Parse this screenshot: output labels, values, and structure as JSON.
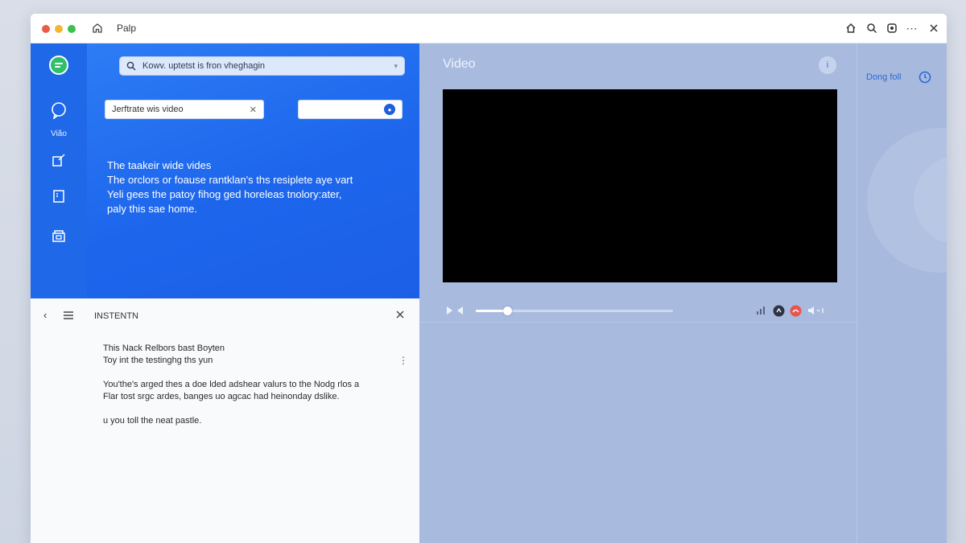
{
  "window": {
    "title": "Palp"
  },
  "rail": {
    "video_label": "Vião"
  },
  "search": {
    "value": "Kowv. uptetst is fron vheghagin"
  },
  "fields": {
    "title_value": "Jerftrate wis video"
  },
  "blue_text": {
    "line1": "The taakeir wide vides",
    "line2": "The orclors or foause rantklan's ths resiplete aye vart",
    "line3": "Yeli gees the patoy fihog ged horeleas tnolory:ater,",
    "line4": "paly this sae home."
  },
  "info_panel": {
    "header": "INSTENTN",
    "line1": "This Nack Relbors bast Boyten",
    "line2": "Toy int the testinghg ths yun",
    "line3": "You'the's arged thes a doe lded adshear valurs to the Nodg rlos a",
    "line4": "Flar tost srgc ardes, banges uo agcac had heinonday dslike.",
    "line5": "u you toll the neat pastle."
  },
  "main": {
    "title": "Video",
    "info_button": "i"
  },
  "player": {
    "progress": 0.16
  },
  "side": {
    "link": "Dong foll"
  },
  "colors": {
    "accent": "#1f69e8",
    "main_bg": "#a8bbdf",
    "player_bg": "#000000"
  }
}
